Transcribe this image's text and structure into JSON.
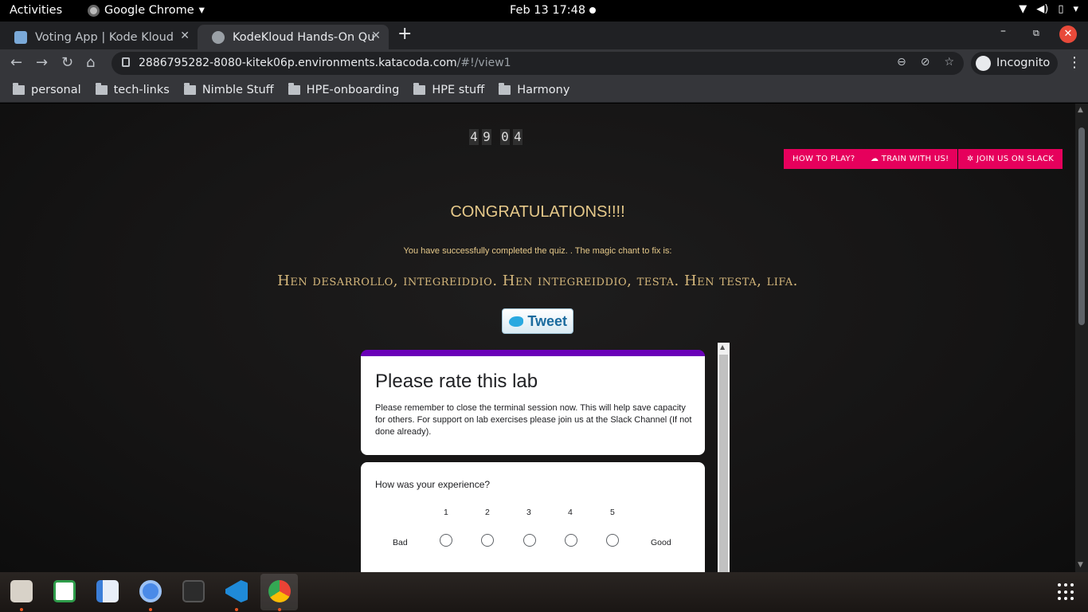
{
  "topbar": {
    "activities": "Activities",
    "app_name": "Google Chrome",
    "clock": "Feb 13  17:48"
  },
  "tabs": [
    {
      "title": "Voting App | Kode Kloud",
      "active": false
    },
    {
      "title": "KodeKloud Hands-On Qui",
      "active": true
    }
  ],
  "toolbar": {
    "url_host": "2886795282-8080-kitek06p.environments.katacoda.com",
    "url_path": "/#!/view1",
    "incognito_label": "Incognito"
  },
  "bookmarks": [
    "personal",
    "tech-links",
    "Nimble Stuff",
    "HPE-onboarding",
    "HPE stuff",
    "Harmony"
  ],
  "page": {
    "timer_digits": [
      "4",
      "9",
      "0",
      "4"
    ],
    "buttons": {
      "how_to_play": "HOW TO PLAY?",
      "train": "TRAIN WITH US!",
      "slack": "JOIN US ON SLACK"
    },
    "congrats": "CONGRATULATIONS!!!!",
    "subtext": "You have successfully completed the quiz. . The magic chant to fix is:",
    "chant": "Hen desarrollo, integreiddio. Hen integreiddio, testa. Hen testa, lifa.",
    "tweet_label": "Tweet"
  },
  "form": {
    "title": "Please rate this lab",
    "description": "Please remember to close the terminal session now. This will help save capacity for others. For support on lab exercises please join us at the Slack Channel (If not done already).",
    "question": "How was your experience?",
    "scale": [
      "1",
      "2",
      "3",
      "4",
      "5"
    ],
    "low_label": "Bad",
    "high_label": "Good"
  },
  "colors": {
    "accent_pink": "#e6005c",
    "form_header": "#6a00b8",
    "congrats_gold": "#e6c98a"
  },
  "dock_icons": [
    "files-icon",
    "slack-icon",
    "text-editor-icon",
    "chromium-icon",
    "terminal-icon",
    "vscode-icon",
    "chrome-icon"
  ]
}
